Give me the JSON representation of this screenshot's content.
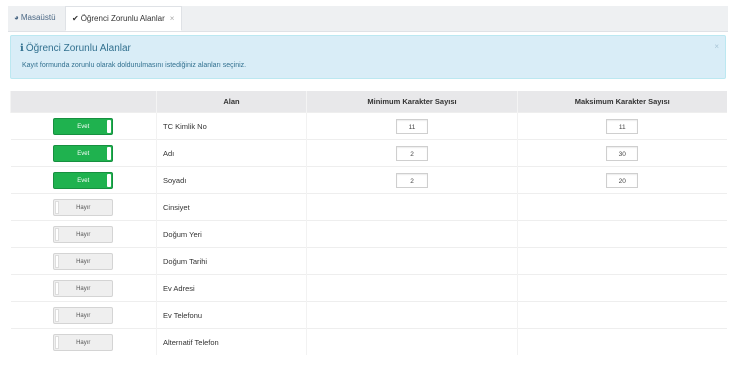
{
  "tabs": [
    {
      "label": "Masaüstü",
      "icon": "dashboard-icon"
    },
    {
      "label": "Öğrenci Zorunlu Alanlar",
      "icon": "check-circle-icon",
      "close": "×"
    }
  ],
  "alert": {
    "icon": "info-icon",
    "title": "Öğrenci Zorunlu Alanlar",
    "description": "Kayıt formunda zorunlu olarak doldurulmasını istediğiniz alanları seçiniz.",
    "close": "×"
  },
  "table": {
    "headers": [
      "",
      "Alan",
      "Minimum Karakter Sayısı",
      "Maksimum Karakter Sayısı"
    ],
    "rows": [
      {
        "toggle": "Evet",
        "on": true,
        "field": "TC Kimlik No",
        "min": "11",
        "max": "11"
      },
      {
        "toggle": "Evet",
        "on": true,
        "field": "Adı",
        "min": "2",
        "max": "30"
      },
      {
        "toggle": "Evet",
        "on": true,
        "field": "Soyadı",
        "min": "2",
        "max": "20"
      },
      {
        "toggle": "Hayır",
        "on": false,
        "field": "Cinsiyet"
      },
      {
        "toggle": "Hayır",
        "on": false,
        "field": "Doğum Yeri"
      },
      {
        "toggle": "Hayır",
        "on": false,
        "field": "Doğum Tarihi"
      },
      {
        "toggle": "Hayır",
        "on": false,
        "field": "Ev Adresi"
      },
      {
        "toggle": "Hayır",
        "on": false,
        "field": "Ev Telefonu"
      },
      {
        "toggle": "Hayır",
        "on": false,
        "field": "Alternatif Telefon"
      }
    ]
  },
  "colors": {
    "toggle_on": "#1fb24f",
    "alert_bg": "#d9edf7",
    "alert_text": "#31708f"
  }
}
